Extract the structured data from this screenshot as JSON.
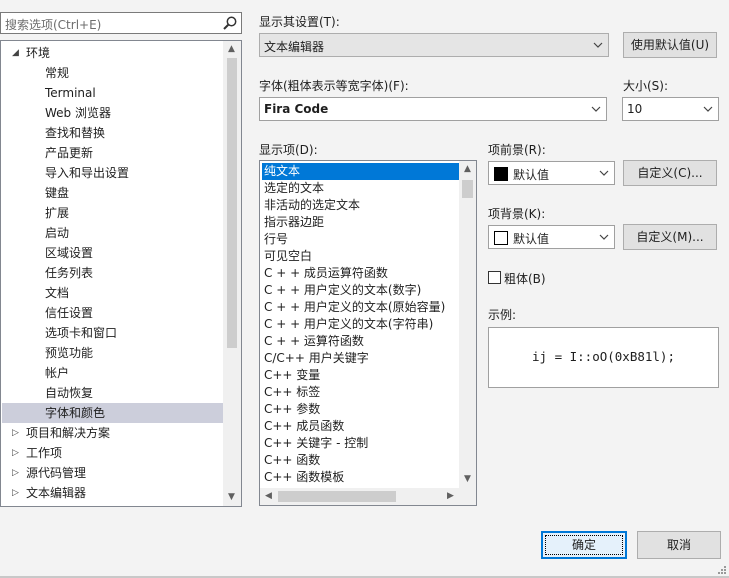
{
  "search": {
    "placeholder": "搜索选项(Ctrl+E)",
    "icon": "search-icon"
  },
  "tree": {
    "items": [
      {
        "label": "环境",
        "level": 0,
        "expanded": true
      },
      {
        "label": "常规",
        "level": 1
      },
      {
        "label": "Terminal",
        "level": 1
      },
      {
        "label": "Web 浏览器",
        "level": 1
      },
      {
        "label": "查找和替换",
        "level": 1
      },
      {
        "label": "产品更新",
        "level": 1
      },
      {
        "label": "导入和导出设置",
        "level": 1
      },
      {
        "label": "键盘",
        "level": 1
      },
      {
        "label": "扩展",
        "level": 1
      },
      {
        "label": "启动",
        "level": 1
      },
      {
        "label": "区域设置",
        "level": 1
      },
      {
        "label": "任务列表",
        "level": 1
      },
      {
        "label": "文档",
        "level": 1
      },
      {
        "label": "信任设置",
        "level": 1
      },
      {
        "label": "选项卡和窗口",
        "level": 1
      },
      {
        "label": "预览功能",
        "level": 1
      },
      {
        "label": "帐户",
        "level": 1
      },
      {
        "label": "自动恢复",
        "level": 1
      },
      {
        "label": "字体和颜色",
        "level": 1,
        "selected": true
      },
      {
        "label": "项目和解决方案",
        "level": 0,
        "expanded": false
      },
      {
        "label": "工作项",
        "level": 0,
        "expanded": false
      },
      {
        "label": "源代码管理",
        "level": 0,
        "expanded": false
      },
      {
        "label": "文本编辑器",
        "level": 0,
        "expanded": false
      }
    ]
  },
  "show_settings": {
    "label": "显示其设置(T):",
    "value": "文本编辑器",
    "default_button": "使用默认值(U)"
  },
  "font": {
    "label": "字体(粗体表示等宽字体)(F):",
    "value": "Fira Code"
  },
  "size": {
    "label": "大小(S):",
    "value": "10"
  },
  "display_items": {
    "label": "显示项(D):",
    "items": [
      "纯文本",
      "选定的文本",
      "非活动的选定文本",
      "指示器边距",
      "行号",
      "可见空白",
      "C + + 成员运算符函数",
      "C + + 用户定义的文本(数字)",
      "C + + 用户定义的文本(原始容量)",
      "C + + 用户定义的文本(字符串)",
      "C + + 运算符函数",
      "C/C++ 用户关键字",
      "C++ 变量",
      "C++ 标签",
      "C++ 参数",
      "C++ 成员函数",
      "C++ 关键字 - 控制",
      "C++ 函数",
      "C++ 函数模板"
    ],
    "selected_index": 0
  },
  "foreground": {
    "label": "项前景(R):",
    "value": "默认值",
    "swatch_color": "#000000",
    "custom_button": "自定义(C)..."
  },
  "background": {
    "label": "项背景(K):",
    "value": "默认值",
    "swatch_color": "#ffffff",
    "custom_button": "自定义(M)..."
  },
  "bold": {
    "label": "粗体(B)",
    "checked": false
  },
  "sample": {
    "label": "示例:",
    "text": "ij = I::oO(0xB81l);"
  },
  "footer": {
    "ok": "确定",
    "cancel": "取消"
  },
  "colors": {
    "selection_blue": "#0078d7",
    "tree_selected": "#cccedb"
  }
}
